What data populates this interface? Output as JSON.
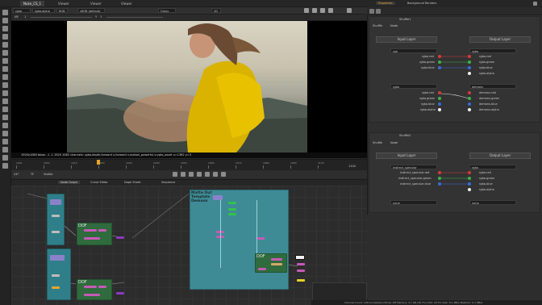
{
  "top_tabs": [
    "Nuke_CS_1",
    "Viewer",
    "Viewer",
    "Viewer"
  ],
  "viewer_toolbar": {
    "channels": "rgba",
    "layer": "rgba.alpha",
    "colorspace": "RGB",
    "display": "sRGB (default)",
    "zoom": "1:1",
    "view": "Grays",
    "mode": "2D"
  },
  "viewer_toolbar2": {
    "gain_label": "f/8",
    "gain_value": "1",
    "y_label": "Y",
    "y_value": "1"
  },
  "viewer_status": "1920x1080 bbox: -1 -1 1920 1082 channels: rgba,depth,forward u,forward v,motion_powerful,crypto_asset  x=1362 y=3",
  "timeline": {
    "fps_label": "24*",
    "fps_value": "TF",
    "visible_label": "Visible",
    "frames": [
      "1001",
      "1003",
      "1014",
      "1023",
      "1033",
      "1043",
      "1053",
      "1063",
      "1073",
      "1083",
      "1093",
      "1103"
    ],
    "end_frame": "1104"
  },
  "node_tabs": [
    "Node Graph",
    "Curve Editor",
    "Dope Sheet",
    "Sequence"
  ],
  "properties": {
    "tabs": [
      "Properties",
      "Background Renders"
    ]
  },
  "shuffle1": {
    "title": "Shuffle1",
    "tabs": [
      "Shuffle",
      "Node"
    ],
    "input_header": "Input Layer",
    "output_header": "Output Layer",
    "in1": "rgb",
    "in1_rows": [
      "rgba.red",
      "rgba.green",
      "rgba.blue"
    ],
    "in2": "rgba",
    "in2_rows": [
      "rgba.red",
      "rgba.green",
      "rgba.blue",
      "rgba.alpha"
    ],
    "out1": "rgba",
    "out1_rows": [
      "rgba.red",
      "rgba.green",
      "rgba.blue",
      "rgba.alpha"
    ],
    "out2": "demons",
    "out2_rows": [
      "demons.red",
      "demons.green",
      "demons.blue",
      "demons.alpha"
    ]
  },
  "shuffle2": {
    "title": "Shuffle2",
    "tabs": [
      "Shuffle",
      "Node"
    ],
    "input_header": "Input Layer",
    "output_header": "Output Layer",
    "in1": "indirect_specular",
    "in1_rows": [
      "indirect_specular.red",
      "indirect_specular.green",
      "indirect_specular.blue"
    ],
    "in2": "none",
    "out1": "rgba",
    "out1_rows": [
      "rgba.red",
      "rgba.green",
      "rgba.blue",
      "rgba.alpha"
    ],
    "out2": "none"
  },
  "graph": {
    "backdrop1": "Matte Out Template Demons",
    "dof1": "DOF",
    "dof2": "DOF",
    "dof3": "DOF"
  },
  "footer_status": "Channel Count: 128  Localization Mode: Off  Memory: 4.7 GB (29.7%)  CPU: 26.5%  Disk: 8.1 MB/s  Network: 0.1 MB/s",
  "colors": {
    "accent": "#e6a52a",
    "node_teal": "#2f7f8a",
    "node_green": "#2f6b3d",
    "backdrop": "#3e8b96"
  }
}
